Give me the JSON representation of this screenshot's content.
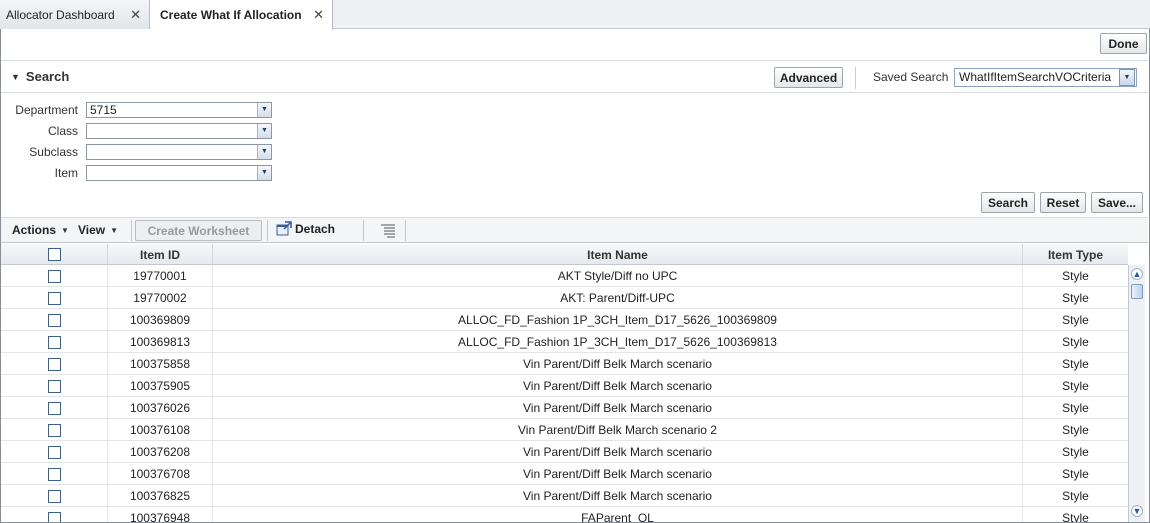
{
  "tabs": [
    {
      "label": "Allocator Dashboard",
      "active": false
    },
    {
      "label": "Create What If Allocation",
      "active": true
    }
  ],
  "header": {
    "done_label": "Done"
  },
  "search": {
    "title": "Search",
    "advanced_label": "Advanced",
    "saved_search_label": "Saved Search",
    "saved_search_value": "WhatIfItemSearchVOCriteria",
    "fields": {
      "department": {
        "label": "Department",
        "value": "5715"
      },
      "class": {
        "label": "Class",
        "value": ""
      },
      "subclass": {
        "label": "Subclass",
        "value": ""
      },
      "item": {
        "label": "Item",
        "value": ""
      }
    },
    "search_button": "Search",
    "reset_button": "Reset",
    "save_button": "Save..."
  },
  "toolbar": {
    "actions_label": "Actions",
    "view_label": "View",
    "create_worksheet_label": "Create Worksheet",
    "detach_label": "Detach"
  },
  "table": {
    "columns": [
      "Item ID",
      "Item Name",
      "Item Type"
    ],
    "rows": [
      {
        "id": "19770001",
        "name": "AKT Style/Diff no UPC",
        "type": "Style"
      },
      {
        "id": "19770002",
        "name": "AKT: Parent/Diff-UPC",
        "type": "Style"
      },
      {
        "id": "100369809",
        "name": "ALLOC_FD_Fashion 1P_3CH_Item_D17_5626_100369809",
        "type": "Style"
      },
      {
        "id": "100369813",
        "name": "ALLOC_FD_Fashion 1P_3CH_Item_D17_5626_100369813",
        "type": "Style"
      },
      {
        "id": "100375858",
        "name": "Vin Parent/Diff Belk March scenario",
        "type": "Style"
      },
      {
        "id": "100375905",
        "name": "Vin Parent/Diff Belk March scenario",
        "type": "Style"
      },
      {
        "id": "100376026",
        "name": "Vin Parent/Diff Belk March scenario",
        "type": "Style"
      },
      {
        "id": "100376108",
        "name": "Vin Parent/Diff Belk March scenario 2",
        "type": "Style"
      },
      {
        "id": "100376208",
        "name": "Vin Parent/Diff Belk March scenario",
        "type": "Style"
      },
      {
        "id": "100376708",
        "name": "Vin Parent/Diff Belk March scenario",
        "type": "Style"
      },
      {
        "id": "100376825",
        "name": "Vin Parent/Diff Belk March scenario",
        "type": "Style"
      },
      {
        "id": "100376948",
        "name": "FAParent_OL",
        "type": "Style"
      }
    ]
  }
}
